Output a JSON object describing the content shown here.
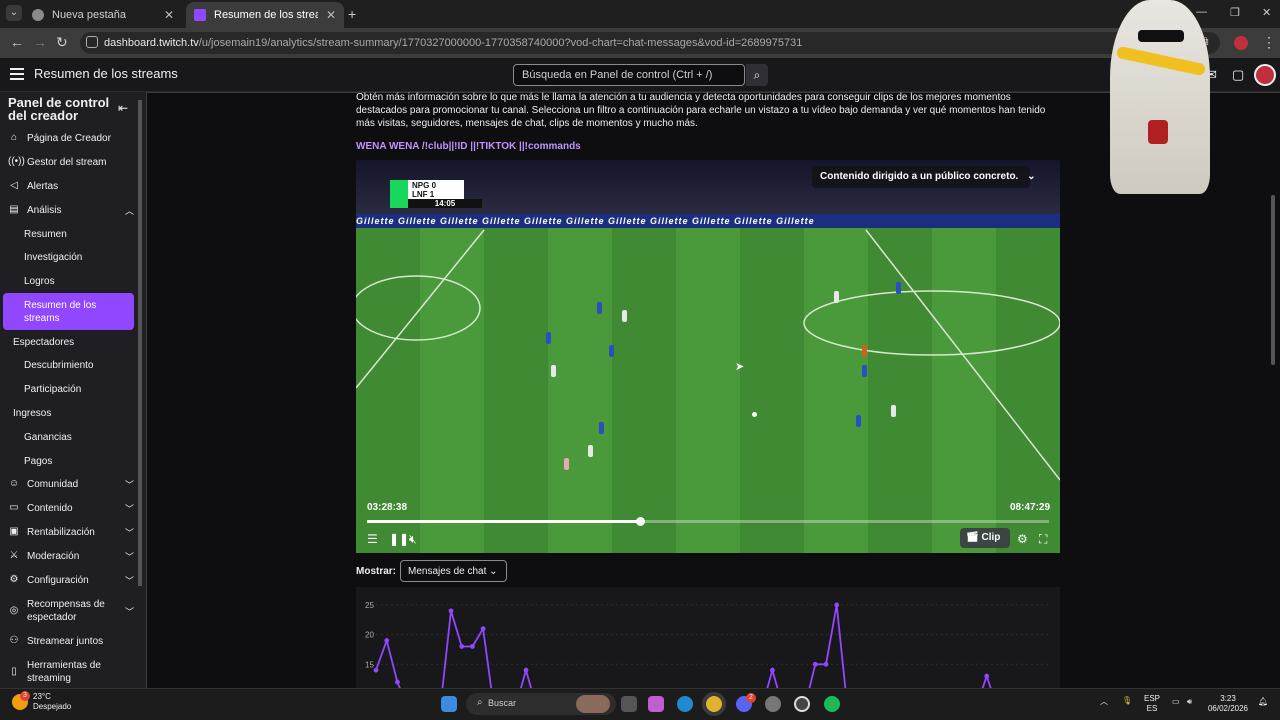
{
  "browser": {
    "tabs": [
      {
        "title": "Nueva pestaña",
        "active": false
      },
      {
        "title": "Resumen de los streams - Twitch",
        "active": true
      }
    ],
    "url_domain": "dashboard.twitch.tv",
    "url_path": "/u/josemain19/analytics/stream-summary/1770327000000-1770358740000?vod-chart=chat-messages&vod-id=2689975731"
  },
  "topnav": {
    "page_title": "Resumen de los streams",
    "search_placeholder": "Búsqueda en Panel de control (Ctrl + /)"
  },
  "sidebar": {
    "title": "Panel de control del creador",
    "items": [
      {
        "label": "Página de Creador",
        "icon": "house-icon"
      },
      {
        "label": "Gestor del stream",
        "icon": "broadcast-icon"
      },
      {
        "label": "Alertas",
        "icon": "megaphone-icon"
      },
      {
        "label": "Análisis",
        "icon": "analytics-icon",
        "expanded": true
      }
    ],
    "analytics_sub": [
      "Resumen",
      "Investigación",
      "Logros"
    ],
    "active_item": "Resumen de los streams",
    "section_viewers": "Espectadores",
    "viewers_sub": [
      "Descubrimiento",
      "Participación"
    ],
    "section_income": "Ingresos",
    "income_sub": [
      "Ganancias",
      "Pagos"
    ],
    "bottom_items": [
      {
        "label": "Comunidad",
        "icon": "community-icon"
      },
      {
        "label": "Contenido",
        "icon": "content-icon"
      },
      {
        "label": "Rentabilización",
        "icon": "money-icon"
      },
      {
        "label": "Moderación",
        "icon": "sword-icon"
      },
      {
        "label": "Configuración",
        "icon": "gear-icon"
      },
      {
        "label": "Recompensas de espectador",
        "icon": "reward-icon"
      },
      {
        "label": "Streamear juntos",
        "icon": "users-plus-icon"
      },
      {
        "label": "Herramientas de streaming",
        "icon": "tools-icon"
      }
    ]
  },
  "main": {
    "intro_text": "Obtén más información sobre lo que más le llama la atención a tu audiencia y detecta oportunidades para conseguir clips de los mejores momentos destacados para promocionar tu canal. Selecciona un filtro a continuación para echarle un vistazo a tu vídeo bajo demanda y ver qué momentos han tenido más visitas, seguidores, mensajes de chat, clips de momentos y mucho más.",
    "stream_title": "WENA WENA /!club||!ID ||!TIKTOK ||!commands",
    "video": {
      "overlay_text": "Contenido dirigido a un público concreto.",
      "score_team1": "NPG",
      "score_team2": "LNF",
      "score1": "0",
      "score2": "1",
      "match_clock": "14:05",
      "ad_text": "Gillette    Gillette    Gillette    Gillette    Gillette    Gillette    Gillette    Gillette    Gillette    Gillette    Gillette",
      "time_current": "03:28:38",
      "time_total": "08:47:29",
      "progress": 0.4,
      "clip_label": "Clip"
    },
    "show_label": "Mostrar:",
    "show_value": "Mensajes de chat"
  },
  "chart_data": {
    "type": "line",
    "title": "",
    "xlabel": "",
    "ylabel": "",
    "y_ticks": [
      "25",
      "20",
      "15"
    ],
    "ylim": [
      11,
      26
    ],
    "color": "#9147ff",
    "grid": true,
    "values": [
      14,
      19,
      12,
      0,
      0,
      0,
      0,
      24,
      18,
      18,
      21,
      0,
      0,
      0,
      14,
      0,
      0,
      0,
      0,
      0,
      0,
      0,
      0,
      0,
      0,
      0,
      0,
      0,
      0,
      0,
      0,
      0,
      0,
      0,
      0,
      0,
      0,
      14,
      0,
      0,
      0,
      15,
      15,
      25,
      0,
      0,
      0,
      0,
      0,
      0,
      0,
      0,
      0,
      0,
      0,
      0,
      0,
      13,
      0,
      0,
      0,
      0,
      0,
      0
    ]
  },
  "taskbar": {
    "weather_temp": "23°C",
    "weather_text": "Despejado",
    "search_label": "Buscar",
    "lang1": "ESP",
    "lang2": "ES",
    "time": "3:23",
    "date": "06/02/2026",
    "discord_badge": "2",
    "weather_badge": "3"
  }
}
